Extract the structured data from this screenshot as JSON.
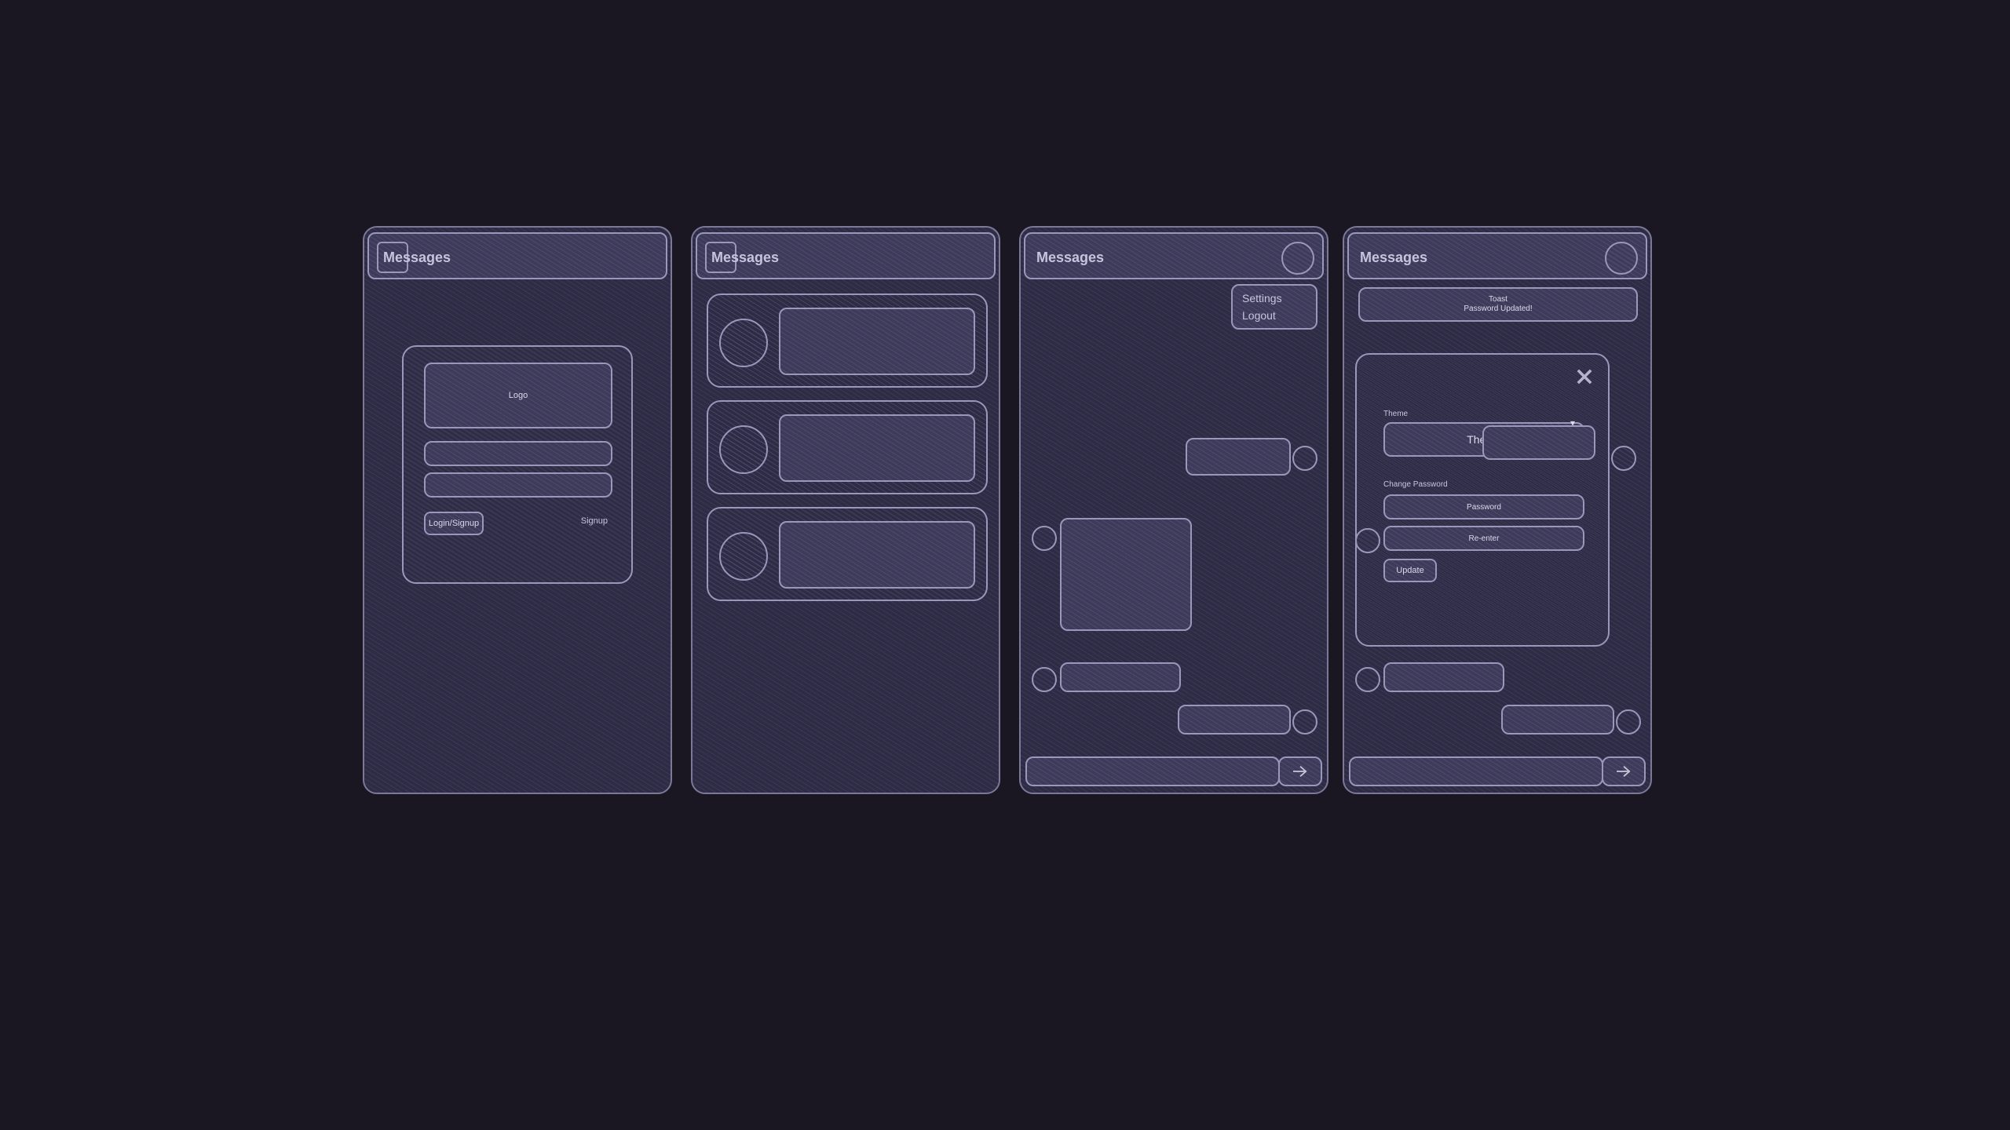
{
  "app_title": "Messages",
  "screens": {
    "login": {
      "logo_label": "Logo",
      "login_btn": "Login/Signup",
      "signup_link": "Signup"
    },
    "menu": {
      "settings": "Settings",
      "logout": "Logout"
    },
    "settings_modal": {
      "toast_title": "Toast",
      "toast_body": "Password Updated!",
      "theme_label": "Theme",
      "theme_value": "Theme",
      "change_pw_label": "Change Password",
      "pw_placeholder": "Password",
      "pw2_placeholder": "Re-enter",
      "update_btn": "Update"
    }
  }
}
